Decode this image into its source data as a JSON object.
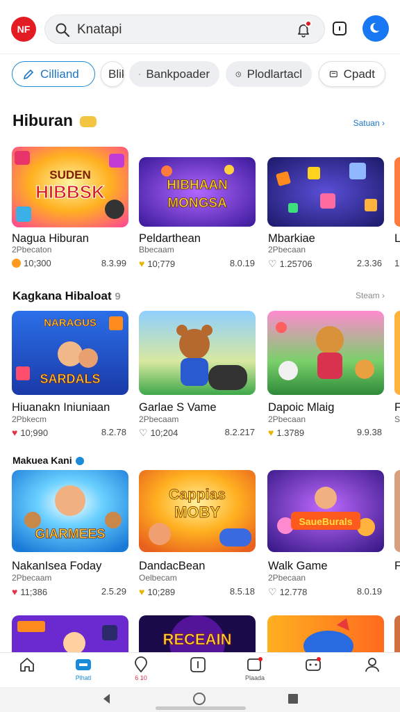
{
  "header": {
    "logo_text": "NF",
    "search_value": "Knatapi",
    "brand_color": "#e31b23",
    "accent_color": "#1877f2"
  },
  "chips": [
    {
      "label": "Cilliand",
      "icon": "pencil-icon",
      "state": "selected"
    },
    {
      "label": "Blik",
      "icon": "square-icon"
    },
    {
      "label": "Bankpoader",
      "icon": "tag-icon"
    },
    {
      "label": "Plodlartacl",
      "icon": "clock-icon"
    },
    {
      "label": "Cpadt",
      "icon": "chat-icon"
    }
  ],
  "sections": [
    {
      "title": "Hiburan",
      "see_all": "Satuan",
      "see_all_color": "#1a74c4",
      "cards": [
        {
          "title": "Nagua Hiburan",
          "sub": "2Pbecaton",
          "stat": "10;300",
          "price": "8.3.99",
          "icon": "orange-coin-icon",
          "art_text": [
            "SUDEN",
            "HIBBSK"
          ],
          "theme": "sunburst"
        },
        {
          "title": "Peldarthean",
          "sub": "Bbecaam",
          "stat": "10;779",
          "price": "8.0.19",
          "icon": "gold-heart-icon",
          "art_text": [
            "HIBHAAN",
            "MONGSA"
          ],
          "theme": "purple"
        },
        {
          "title": "Mbarkiae",
          "sub": "2Pbecaan",
          "stat": "1.25706",
          "price": "2.3.36",
          "icon": "outline-heart-icon",
          "art_text": [],
          "theme": "blocks"
        },
        {
          "title": "L",
          "sub": "",
          "stat": "1",
          "price": "",
          "icon": "",
          "art_text": [],
          "theme": "edge"
        }
      ]
    },
    {
      "title": "Kagkana Hibaloat",
      "see_all": "Steam",
      "see_all_color": "#8a8a8a",
      "cards": [
        {
          "title": "Hiuanakn Iniuniaan",
          "sub": "2Pbkecm",
          "stat": "10;990",
          "price": "8.2.78",
          "icon": "red-heart-icon",
          "art_text": [
            "NARAGUS",
            "SARDALS"
          ],
          "theme": "kids"
        },
        {
          "title": "Garlae S Vame",
          "sub": "2Pbecaam",
          "stat": "10;204",
          "price": "8.2.217",
          "icon": "outline-heart-icon",
          "art_text": [],
          "theme": "bear"
        },
        {
          "title": "Dapoic Mlaig",
          "sub": "2Pbecaan",
          "stat": "1.3789",
          "price": "9.9.38",
          "icon": "gold-heart-icon",
          "art_text": [],
          "theme": "adventure"
        },
        {
          "title": "F",
          "sub": "S",
          "stat": "",
          "price": "",
          "icon": "",
          "art_text": [],
          "theme": "edge"
        }
      ]
    },
    {
      "title": "Makuea Kani",
      "see_all": "",
      "see_all_color": "#8a8a8a",
      "cards": [
        {
          "title": "NakanIsea Foday",
          "sub": "2Pbecaam",
          "stat": "11;386",
          "price": "2.5.29",
          "icon": "red-heart-icon",
          "art_text": [
            "GIARMEES"
          ],
          "theme": "burst"
        },
        {
          "title": "DandacBean",
          "sub": "Oelbecam",
          "stat": "10;289",
          "price": "8.5.18",
          "icon": "gold-heart-icon",
          "art_text": [
            "Cappias",
            "MOBY"
          ],
          "theme": "gold"
        },
        {
          "title": "Walk Game",
          "sub": "2Pbecaan",
          "stat": "12.778",
          "price": "8.0.19",
          "icon": "outline-heart-icon",
          "art_text": [
            "SaueBurals"
          ],
          "theme": "party"
        },
        {
          "title": "F",
          "sub": "",
          "stat": "",
          "price": "",
          "icon": "",
          "art_text": [],
          "theme": "edge"
        }
      ]
    },
    {
      "title": "",
      "see_all": "",
      "see_all_color": "#8a8a8a",
      "cards": [
        {
          "art_text": [],
          "theme": "space"
        },
        {
          "art_text": [
            "RECEAIN"
          ],
          "theme": "neon"
        },
        {
          "art_text": [],
          "theme": "fish"
        },
        {
          "art_text": [],
          "theme": "edge"
        }
      ]
    }
  ],
  "bottom_nav": [
    {
      "label": "",
      "icon": "home-icon"
    },
    {
      "label": "Plhatl",
      "icon": "gamepad-icon",
      "active": true
    },
    {
      "label": "6 10",
      "icon": "map-pin-icon"
    },
    {
      "label": "",
      "icon": "compass-icon"
    },
    {
      "label": "Plaada",
      "icon": "gift-icon"
    },
    {
      "label": "",
      "icon": "game-controller-icon"
    },
    {
      "label": "",
      "icon": "user-icon"
    }
  ],
  "system_nav": [
    "back-icon",
    "home-circle-icon",
    "recents-icon"
  ]
}
